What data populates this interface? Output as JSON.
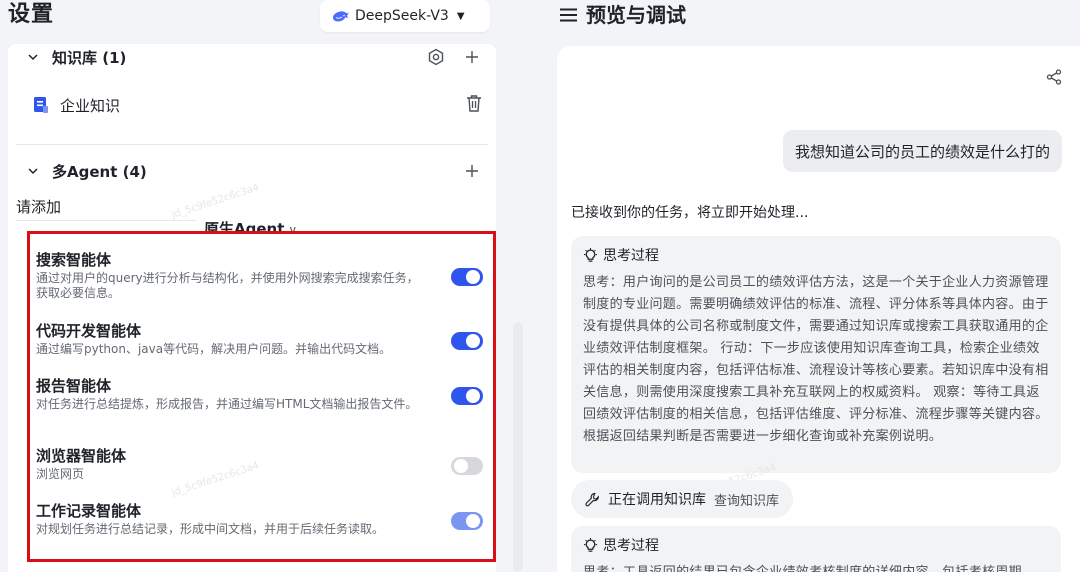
{
  "settings": {
    "title": "设置",
    "model": {
      "label": "DeepSeek-V3"
    },
    "knowledge": {
      "header": "知识库 (1)",
      "items": [
        {
          "label": "企业知识"
        }
      ]
    },
    "multi_agent": {
      "header": "多Agent (4)",
      "hint": "请添加",
      "source_label": "原生Agent",
      "agents": [
        {
          "name": "搜索智能体",
          "desc": "通过对用户的query进行分析与结构化，并使用外网搜索完成搜索任务，获取必要信息。",
          "enabled": true
        },
        {
          "name": "代码开发智能体",
          "desc": "通过编写python、java等代码，解决用户问题。并输出代码文档。",
          "enabled": true
        },
        {
          "name": "报告智能体",
          "desc": "对任务进行总结提炼，形成报告，并通过编写HTML文档输出报告文件。",
          "enabled": true
        },
        {
          "name": "浏览器智能体",
          "desc": "浏览网页",
          "enabled": false
        },
        {
          "name": "工作记录智能体",
          "desc": "对规划任务进行总结记录，形成中间文档，并用于后续任务读取。",
          "enabled": true
        }
      ]
    },
    "watermark": "jd_5c9fe52c6c3a4"
  },
  "preview": {
    "title": "预览与调试",
    "user_message": "我想知道公司的员工的绩效是什么打的",
    "ack": "已接收到你的任务，将立即开始处理...",
    "thinking_blocks": [
      {
        "label": "思考过程",
        "text": "思考：用户询问的是公司员工的绩效评估方法，这是一个关于企业人力资源管理制度的专业问题。需要明确绩效评估的标准、流程、评分体系等具体内容。由于没有提供具体的公司名称或制度文件，需要通过知识库或搜索工具获取通用的企业绩效评估制度框架。 行动：下一步应该使用知识库查询工具，检索企业绩效评估的相关制度内容，包括评估标准、流程设计等核心要素。若知识库中没有相关信息，则需使用深度搜索工具补充互联网上的权威资料。 观察：等待工具返回绩效评估制度的相关信息，包括评估维度、评分标准、流程步骤等关键内容。根据返回结果判断是否需要进一步细化查询或补充案例说明。"
      },
      {
        "label": "思考过程",
        "text": "思考：工具返回的结果已包含企业绩效考核制度的详细内容，包括考核周期"
      }
    ],
    "tool_call": {
      "label": "正在调用知识库",
      "detail": "查询知识库"
    }
  },
  "colors": {
    "toggle_on": "#2e56ec",
    "toggle_off": "#d6d8dc",
    "highlight_border": "#d80f16",
    "doc_icon": "#2e56ec"
  }
}
